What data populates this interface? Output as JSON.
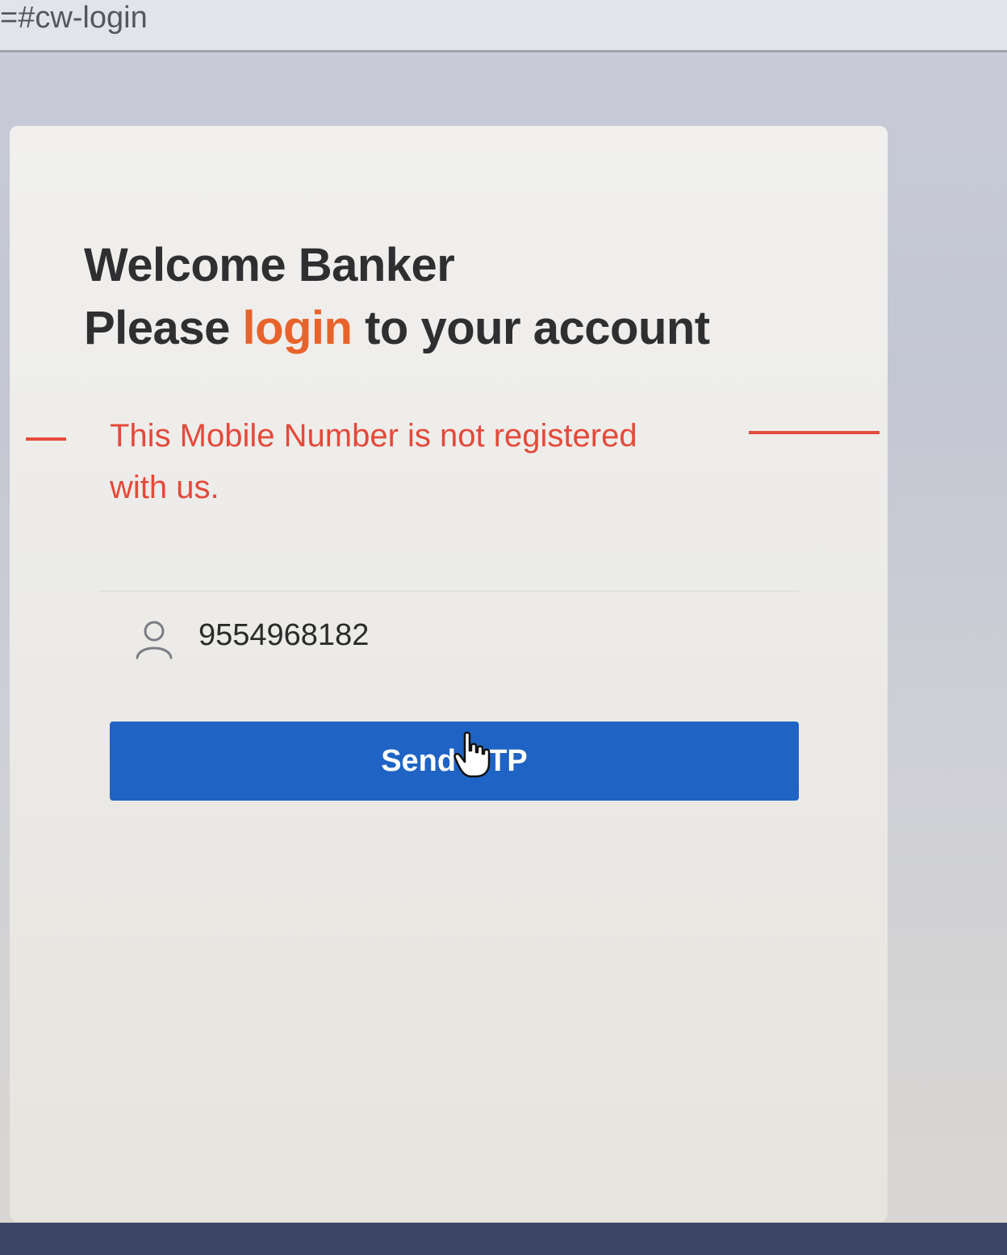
{
  "browser": {
    "url_fragment": "=#cw-login"
  },
  "login": {
    "heading_line1": "Welcome Banker",
    "heading_line2_prefix": "Please ",
    "heading_line2_accent": "login",
    "heading_line2_suffix": " to your account",
    "error_message": "This Mobile Number is not registered with us.",
    "mobile_value": "9554968182",
    "send_otp_label": "Send OTP",
    "user_icon": "user-icon",
    "accent_color": "#e8632b",
    "error_color": "#e5493a",
    "button_color": "#1f64c4"
  }
}
